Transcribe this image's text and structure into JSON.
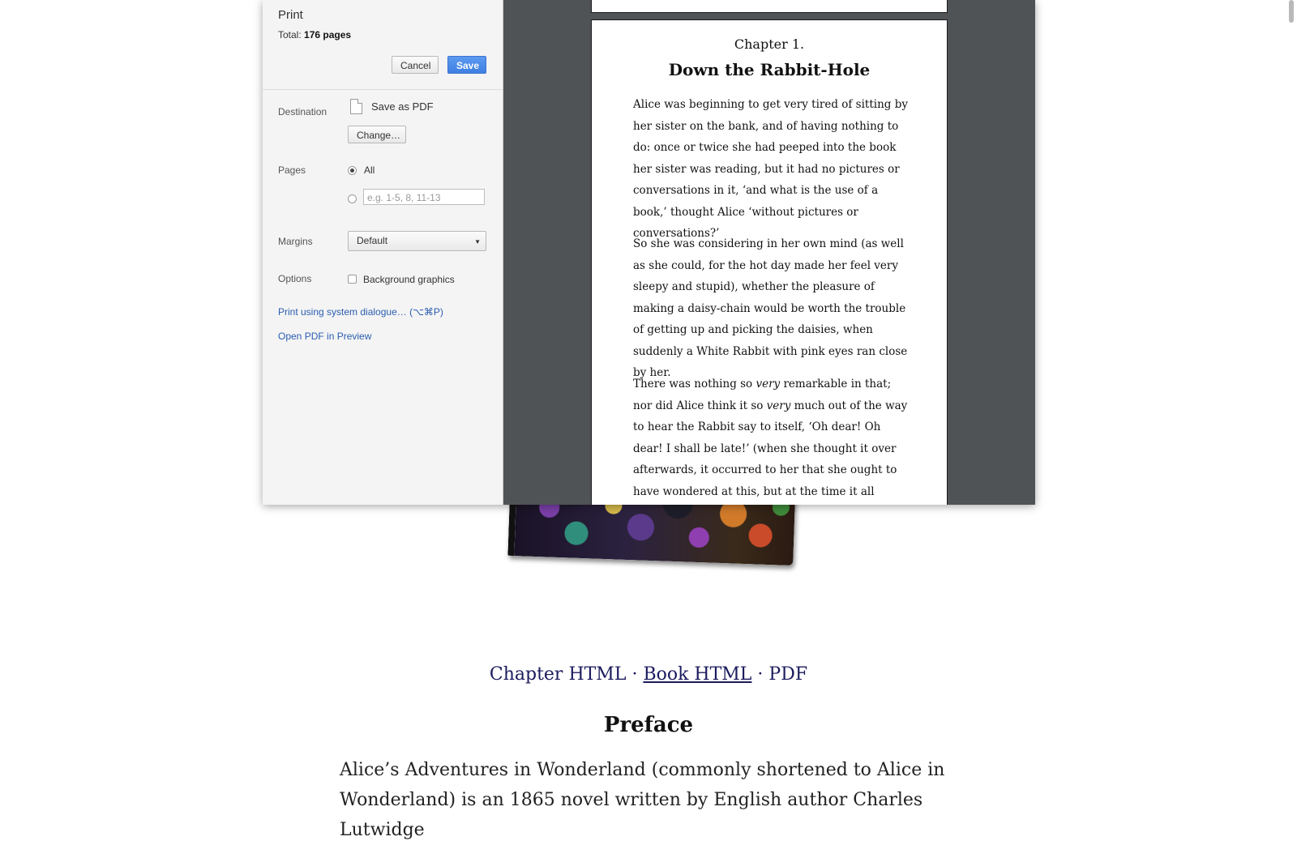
{
  "print_dialog": {
    "title": "Print",
    "total_prefix": "Total: ",
    "total_value": "176 pages",
    "cancel_label": "Cancel",
    "save_label": "Save",
    "destination": {
      "label": "Destination",
      "value": "Save as PDF",
      "change_label": "Change…"
    },
    "pages": {
      "label": "Pages",
      "all_label": "All",
      "all_selected": true,
      "range_placeholder": "e.g. 1-5, 8, 11-13"
    },
    "margins": {
      "label": "Margins",
      "selected": "Default"
    },
    "options": {
      "label": "Options",
      "background_graphics_label": "Background graphics",
      "background_graphics_checked": false
    },
    "system_dialog_link": "Print using system dialogue… (⌥⌘P)",
    "open_pdf_link": "Open PDF in Preview"
  },
  "preview_page": {
    "chapter_number": "Chapter 1.",
    "chapter_title": "Down the Rabbit-Hole",
    "paragraph1": "Alice was beginning to get very tired of sitting by her sister on the bank, and of having nothing to do: once or twice she had peeped into the book her sister was reading, but it had no pictures or conversations in it, ‘and what is the use of a book,’ thought Alice ‘without pictures or conversations?’",
    "paragraph2": "So she was considering in her own mind (as well as she could, for the hot day made her feel very sleepy and stupid), whether the pleasure of making a daisy-chain would be worth the trouble of getting up and picking the daisies, when suddenly a White Rabbit with pink eyes ran close by her.",
    "paragraph3_a": "There was nothing so ",
    "paragraph3_em1": "very",
    "paragraph3_b": " remarkable in that; nor did Alice think it so ",
    "paragraph3_em2": "very",
    "paragraph3_c": " much out of the way to hear the Rabbit say to itself, ‘Oh dear! Oh dear! I shall be late!’ (when she thought it over afterwards, it occurred to her that she ought to have wondered at this, but at the time it all seemed quite natural);"
  },
  "page": {
    "links": {
      "chapter_html": "Chapter HTML",
      "separator": " · ",
      "book_html": "Book HTML",
      "pdf": "PDF"
    },
    "preface_title": "Preface",
    "preface_text": "Alice’s Adventures in Wonderland (commonly shortened to Alice in Wonderland) is an 1865 novel written by English author Charles Lutwidge"
  }
}
